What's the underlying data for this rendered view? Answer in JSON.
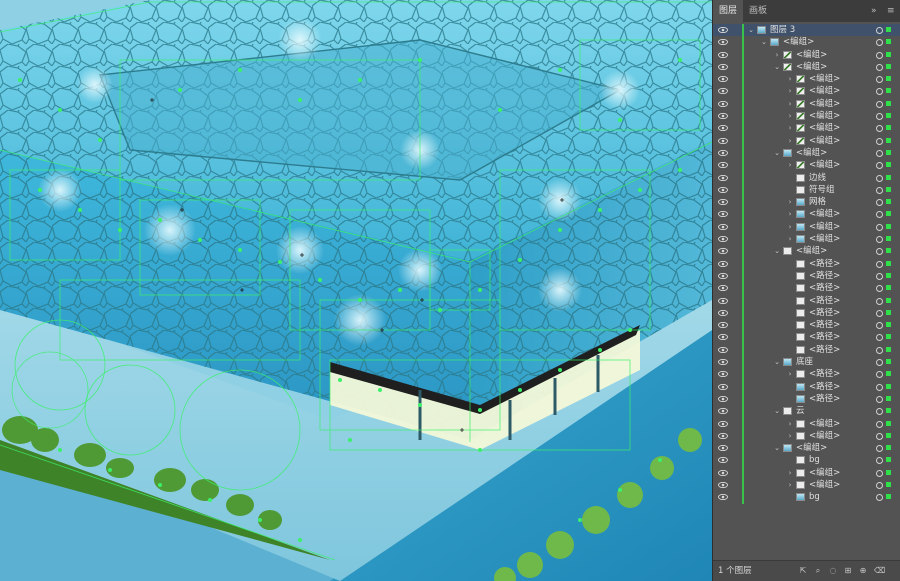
{
  "panel": {
    "tabs": [
      {
        "label": "图层",
        "active": true
      },
      {
        "label": "画板",
        "active": false
      }
    ],
    "tab_controls": {
      "collapse": "»",
      "menu": "≡"
    },
    "layers": [
      {
        "label": "图层 3",
        "indent": 0,
        "expanded": true,
        "thumb": "sky",
        "selected": true
      },
      {
        "label": "<编组>",
        "indent": 1,
        "expanded": true,
        "thumb": "sky"
      },
      {
        "label": "<编组>",
        "indent": 2,
        "expanded": false,
        "thumb": "leaf"
      },
      {
        "label": "<编组>",
        "indent": 2,
        "expanded": true,
        "thumb": "leaf"
      },
      {
        "label": "<编组>",
        "indent": 3,
        "expanded": false,
        "thumb": "leaf"
      },
      {
        "label": "<编组>",
        "indent": 3,
        "expanded": false,
        "thumb": "leaf"
      },
      {
        "label": "<编组>",
        "indent": 3,
        "expanded": false,
        "thumb": "leaf"
      },
      {
        "label": "<编组>",
        "indent": 3,
        "expanded": false,
        "thumb": "leaf"
      },
      {
        "label": "<编组>",
        "indent": 3,
        "expanded": false,
        "thumb": "leaf"
      },
      {
        "label": "<编组>",
        "indent": 3,
        "expanded": false,
        "thumb": "leaf"
      },
      {
        "label": "<编组>",
        "indent": 2,
        "expanded": true,
        "thumb": "sky"
      },
      {
        "label": "<编组>",
        "indent": 3,
        "expanded": false,
        "thumb": "leaf"
      },
      {
        "label": "边线",
        "indent": 3,
        "expanded": null,
        "thumb": "plain"
      },
      {
        "label": "符号组",
        "indent": 3,
        "expanded": null,
        "thumb": "plain"
      },
      {
        "label": "网格",
        "indent": 3,
        "expanded": false,
        "thumb": "sky"
      },
      {
        "label": "<编组>",
        "indent": 3,
        "expanded": false,
        "thumb": "sky"
      },
      {
        "label": "<编组>",
        "indent": 3,
        "expanded": false,
        "thumb": "sky"
      },
      {
        "label": "<编组>",
        "indent": 3,
        "expanded": false,
        "thumb": "sky"
      },
      {
        "label": "<编组>",
        "indent": 2,
        "expanded": true,
        "thumb": "plain"
      },
      {
        "label": "<路径>",
        "indent": 3,
        "expanded": null,
        "thumb": "plain"
      },
      {
        "label": "<路径>",
        "indent": 3,
        "expanded": null,
        "thumb": "plain"
      },
      {
        "label": "<路径>",
        "indent": 3,
        "expanded": null,
        "thumb": "plain"
      },
      {
        "label": "<路径>",
        "indent": 3,
        "expanded": null,
        "thumb": "plain"
      },
      {
        "label": "<路径>",
        "indent": 3,
        "expanded": null,
        "thumb": "plain"
      },
      {
        "label": "<路径>",
        "indent": 3,
        "expanded": null,
        "thumb": "plain"
      },
      {
        "label": "<路径>",
        "indent": 3,
        "expanded": null,
        "thumb": "plain"
      },
      {
        "label": "<路径>",
        "indent": 3,
        "expanded": null,
        "thumb": "plain"
      },
      {
        "label": "底座",
        "indent": 2,
        "expanded": true,
        "thumb": "sky"
      },
      {
        "label": "<路径>",
        "indent": 3,
        "expanded": false,
        "thumb": "plain"
      },
      {
        "label": "<路径>",
        "indent": 3,
        "expanded": null,
        "thumb": "sky"
      },
      {
        "label": "<路径>",
        "indent": 3,
        "expanded": null,
        "thumb": "sky"
      },
      {
        "label": "云",
        "indent": 2,
        "expanded": true,
        "thumb": "plain"
      },
      {
        "label": "<编组>",
        "indent": 3,
        "expanded": false,
        "thumb": "plain"
      },
      {
        "label": "<编组>",
        "indent": 3,
        "expanded": false,
        "thumb": "plain"
      },
      {
        "label": "<编组>",
        "indent": 2,
        "expanded": true,
        "thumb": "sky"
      },
      {
        "label": "bg",
        "indent": 3,
        "expanded": null,
        "thumb": "plain"
      },
      {
        "label": "<编组>",
        "indent": 3,
        "expanded": false,
        "thumb": "plain"
      },
      {
        "label": "<编组>",
        "indent": 3,
        "expanded": false,
        "thumb": "plain"
      },
      {
        "label": "bg",
        "indent": 3,
        "expanded": null,
        "thumb": "sky"
      }
    ],
    "footer": {
      "layer_count": "1 个图层"
    }
  },
  "colors": {
    "panel_bg": "#535353",
    "tabbar_bg": "#3c3c3c",
    "selection_bg": "#40526b",
    "layer_color_bar": "#38c24a",
    "canvas_sky": "#7cc4dc",
    "building_top": "#56c2de",
    "selection_green": "#3cf06a"
  }
}
